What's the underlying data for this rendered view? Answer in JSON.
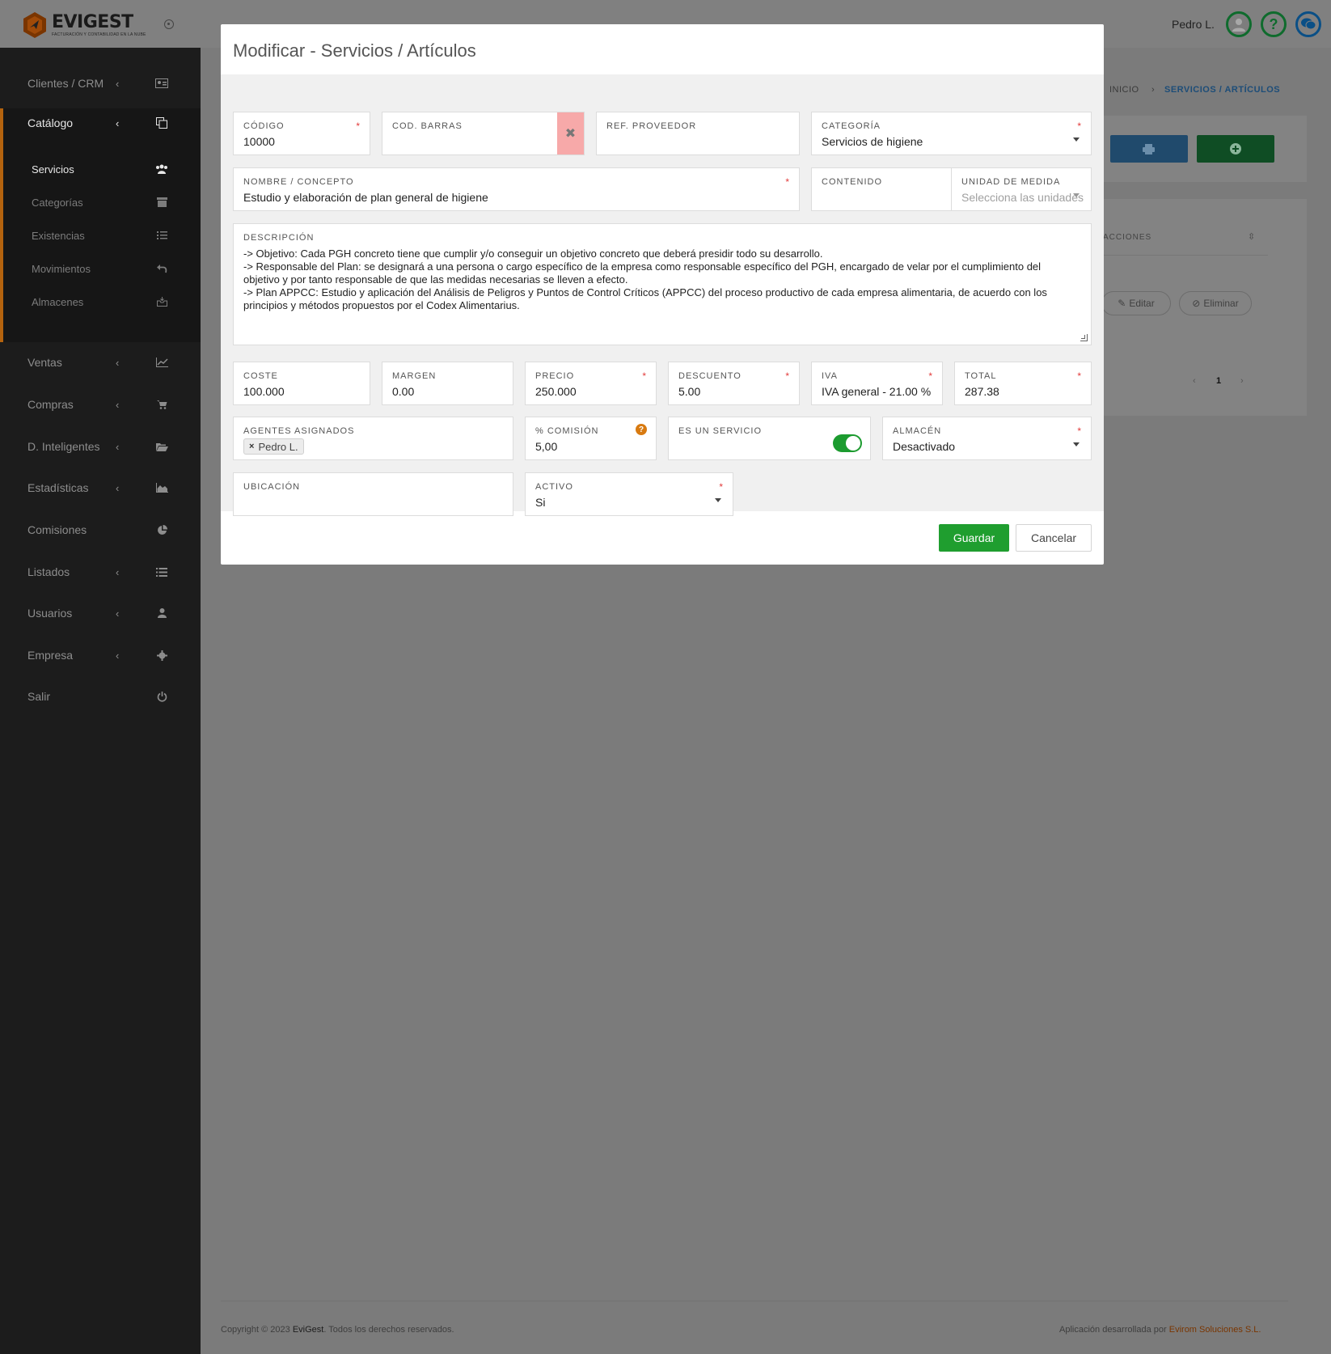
{
  "topbar": {
    "logo_name": "EVIGEST",
    "logo_tagline": "FACTURACIÓN Y CONTABILIDAD EN LA NUBE",
    "user_name": "Pedro L.",
    "help_glyph": "?"
  },
  "sidebar": {
    "items": [
      {
        "label": "Clientes / CRM",
        "icon": "id-card-icon",
        "has_arrow": true
      },
      {
        "label": "Catálogo",
        "icon": "copy-icon",
        "has_arrow": true,
        "active": true
      },
      {
        "label": "Ventas",
        "icon": "line-chart-icon",
        "has_arrow": true
      },
      {
        "label": "Compras",
        "icon": "cart-icon",
        "has_arrow": true
      },
      {
        "label": "D. Inteligentes",
        "icon": "folder-open-icon",
        "has_arrow": true
      },
      {
        "label": "Estadísticas",
        "icon": "area-chart-icon",
        "has_arrow": true
      },
      {
        "label": "Comisiones",
        "icon": "pie-chart-icon",
        "has_arrow": false
      },
      {
        "label": "Listados",
        "icon": "list-icon",
        "has_arrow": true
      },
      {
        "label": "Usuarios",
        "icon": "user-icon",
        "has_arrow": true
      },
      {
        "label": "Empresa",
        "icon": "gear-icon",
        "has_arrow": true
      },
      {
        "label": "Salir",
        "icon": "power-icon",
        "has_arrow": false
      }
    ],
    "catalog_subitems": [
      {
        "label": "Servicios",
        "icon": "users-icon",
        "active": true
      },
      {
        "label": "Categorías",
        "icon": "archive-icon"
      },
      {
        "label": "Existencias",
        "icon": "list-ol-icon"
      },
      {
        "label": "Movimientos",
        "icon": "undo-icon"
      },
      {
        "label": "Almacenes",
        "icon": "inbox-icon"
      }
    ],
    "arrow_glyph": "‹",
    "accent_color": "#b4630e"
  },
  "background_page": {
    "breadcrumb": {
      "home": "INICIO",
      "separator": "›",
      "current": "SERVICIOS / ARTÍCULOS"
    },
    "table_header_actions": "ACCIONES",
    "row_actions": {
      "edit": "Editar",
      "delete": "Eliminar"
    },
    "pagination": {
      "prev": "‹",
      "page": "1",
      "next": "›"
    },
    "footer": {
      "copyright_prefix": "Copyright © 2023",
      "brand": "EviGest",
      "copyright_suffix": ". Todos los derechos reservados.",
      "developed_by_prefix": "Aplicación desarrollada por",
      "developer": "Evirom Soluciones S.L."
    }
  },
  "modal": {
    "title": "Modificar - Servicios / Artículos",
    "required_mark": "*",
    "fields": {
      "codigo": {
        "label": "CÓDIGO",
        "value": "10000",
        "required": true
      },
      "cod_barras": {
        "label": "COD. BARRAS",
        "value": "",
        "clear_glyph": "✖"
      },
      "ref_proveedor": {
        "label": "REF. PROVEEDOR",
        "value": ""
      },
      "categoria": {
        "label": "CATEGORÍA",
        "value": "Servicios de higiene",
        "required": true
      },
      "nombre": {
        "label": "NOMBRE / CONCEPTO",
        "value": "Estudio y elaboración de plan general de higiene",
        "required": true
      },
      "contenido": {
        "label": "CONTENIDO",
        "value": ""
      },
      "unidad_medida": {
        "label": "UNIDAD DE MEDIDA",
        "placeholder": "Selecciona las unidades"
      },
      "descripcion": {
        "label": "DESCRIPCIÓN",
        "value": "-> Objetivo: Cada PGH concreto tiene que cumplir y/o conseguir un objetivo concreto que deberá presidir todo su desarrollo.\n-> Responsable del Plan: se designará a una persona o cargo específico de la empresa como responsable específico del PGH, encargado de velar por el cumplimiento del objetivo y por tanto responsable de que las medidas necesarias se lleven a efecto.\n-> Plan APPCC: Estudio y aplicación del Análisis de Peligros y Puntos de Control Críticos (APPCC) del proceso productivo de cada empresa alimentaria, de acuerdo con los principios y métodos propuestos por el Codex Alimentarius."
      },
      "coste": {
        "label": "COSTE",
        "value": "100.000"
      },
      "margen": {
        "label": "MARGEN",
        "value": "0.00"
      },
      "precio": {
        "label": "PRECIO",
        "value": "250.000",
        "required": true
      },
      "descuento": {
        "label": "DESCUENTO",
        "value": "5.00",
        "required": true
      },
      "iva": {
        "label": "IVA",
        "value": "IVA general - 21.00 %",
        "required": true
      },
      "total": {
        "label": "TOTAL",
        "value": "287.38",
        "required": true
      },
      "agentes": {
        "label": "AGENTES ASIGNADOS",
        "tags": [
          "Pedro L."
        ],
        "remove_glyph": "×"
      },
      "comision": {
        "label": "% COMISIÓN",
        "value": "5,00",
        "help_glyph": "?"
      },
      "es_servicio": {
        "label": "ES UN SERVICIO",
        "checked": true
      },
      "almacen": {
        "label": "ALMACÉN",
        "value": "Desactivado",
        "required": true
      },
      "ubicacion": {
        "label": "UBICACIÓN",
        "value": ""
      },
      "activo": {
        "label": "ACTIVO",
        "value": "Si",
        "required": true
      }
    },
    "buttons": {
      "save": "Guardar",
      "cancel": "Cancelar"
    },
    "colors": {
      "save": "#1f9e2f",
      "required": "#e23b3b",
      "toggle": "#1c9b2f",
      "clear": "#f7a9a9"
    }
  }
}
